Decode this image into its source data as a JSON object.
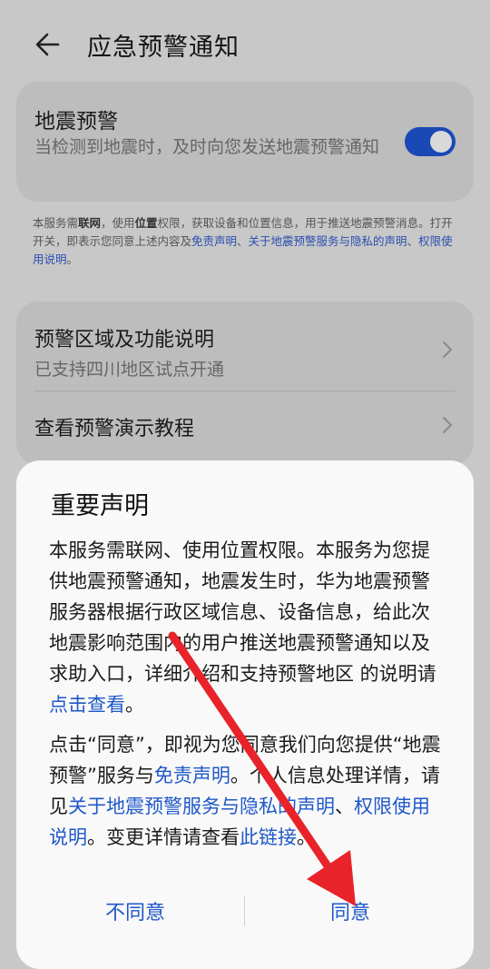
{
  "header": {
    "title": "应急预警通知"
  },
  "earthquake": {
    "title": "地震预警",
    "subtitle": "当检测到地震时，及时向您发送地震预警通知",
    "toggle_on": true
  },
  "notice": {
    "t1": "本服务需",
    "b1": "联网",
    "t2": "，使用",
    "b2": "位置",
    "t3": "权限，获取设备和位置信息，用于推送地震预警消息。打开开关，即表示您同意上述内容及",
    "l1": "免责声明",
    "t4": "、",
    "l2": "关于地震预警服务与隐私的声明",
    "t5": "、",
    "l3": "权限使用说明",
    "t6": "。"
  },
  "list": {
    "item1_title": "预警区域及功能说明",
    "item1_sub": "已支持四川地区试点开通",
    "item2_title": "查看预警演示教程"
  },
  "dialog": {
    "title": "重要声明",
    "p1_text": "本服务需联网、使用位置权限。本服务为您提供地震预警通知，地震发生时，华为地震预警服务器根据行政区域信息、设备信息，给此次地震影响范围内的用户推送地震预警通知以及求助入口，详细介绍和支持预警地区 的说明请",
    "p1_link": "点击查看",
    "p1_end": "。",
    "p2_t1": "点击“同意”，即视为您同意我们向您提供“地震预警”服务与",
    "p2_l1": "免责声明",
    "p2_t2": "。个人信息处理详情，请见",
    "p2_l2": "关于地震预警服务与隐私的声明",
    "p2_t3": "、",
    "p2_l3": "权限使用说明",
    "p2_t4": "。变更详情请查看",
    "p2_l4": "此链接",
    "p2_t5": "。",
    "cancel": "不同意",
    "agree": "同意"
  },
  "colors": {
    "accent": "#1f58c9",
    "toggle": "#1a49b6",
    "arrow": "#e8232a"
  }
}
